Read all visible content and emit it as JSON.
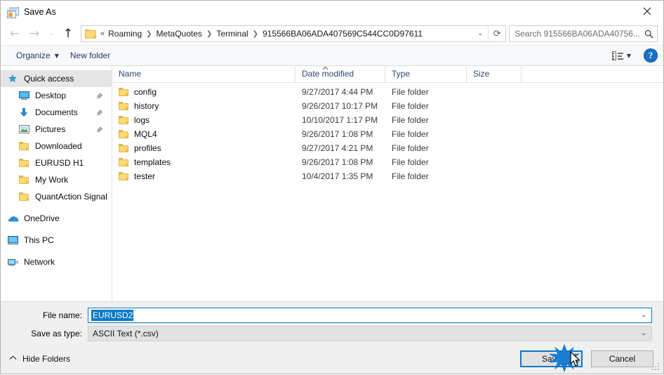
{
  "window": {
    "title": "Save As",
    "icon": "save-as-app-icon",
    "close_label": "✕"
  },
  "nav": {
    "back_icon": "back-arrow-icon",
    "forward_icon": "forward-arrow-icon",
    "recent_icon": "recent-locations-chevron-icon",
    "up_icon": "up-arrow-icon",
    "back_glyph": "←",
    "forward_glyph": "→",
    "recent_glyph": "⌄",
    "up_glyph": "↑"
  },
  "address": {
    "folder_icon": "folder-icon",
    "overflow": "«",
    "crumbs": [
      "Roaming",
      "MetaQuotes",
      "Terminal",
      "915566BA06ADA407569C544CC0D97611"
    ],
    "separator": "❯",
    "dropdown_glyph": "⌄",
    "refresh_glyph": "⟳"
  },
  "search": {
    "placeholder": "Search 915566BA06ADA40756...",
    "icon": "search-icon"
  },
  "command_bar": {
    "organize_label": "Organize",
    "organize_caret": "▼",
    "new_folder_label": "New folder",
    "view_caret": "▼",
    "help_label": "?"
  },
  "sidebar": {
    "items": [
      {
        "label": "Quick access",
        "icon": "star-pin-icon",
        "selected": true,
        "indent": 0,
        "pinned": false
      },
      {
        "label": "Desktop",
        "icon": "desktop-icon",
        "selected": false,
        "indent": 1,
        "pinned": true
      },
      {
        "label": "Documents",
        "icon": "documents-download-icon",
        "selected": false,
        "indent": 1,
        "pinned": true
      },
      {
        "label": "Pictures",
        "icon": "pictures-icon",
        "selected": false,
        "indent": 1,
        "pinned": true
      },
      {
        "label": "Downloaded",
        "icon": "folder-icon",
        "selected": false,
        "indent": 1,
        "pinned": false
      },
      {
        "label": "EURUSD H1",
        "icon": "folder-icon",
        "selected": false,
        "indent": 1,
        "pinned": false
      },
      {
        "label": "My Work",
        "icon": "folder-icon",
        "selected": false,
        "indent": 1,
        "pinned": false
      },
      {
        "label": "QuantAction Signal",
        "icon": "folder-icon",
        "selected": false,
        "indent": 1,
        "pinned": false
      }
    ],
    "groups": [
      {
        "label": "OneDrive",
        "icon": "onedrive-cloud-icon"
      },
      {
        "label": "This PC",
        "icon": "this-pc-icon"
      },
      {
        "label": "Network",
        "icon": "network-icon"
      }
    ],
    "pin_glyph": "📌"
  },
  "filelist": {
    "columns": [
      "Name",
      "Date modified",
      "Type",
      "Size"
    ],
    "sort_caret": "▲",
    "rows": [
      {
        "name": "config",
        "date": "9/27/2017 4:44 PM",
        "type": "File folder",
        "size": ""
      },
      {
        "name": "history",
        "date": "9/26/2017 10:17 PM",
        "type": "File folder",
        "size": ""
      },
      {
        "name": "logs",
        "date": "10/10/2017 1:17 PM",
        "type": "File folder",
        "size": ""
      },
      {
        "name": "MQL4",
        "date": "9/26/2017 1:08 PM",
        "type": "File folder",
        "size": ""
      },
      {
        "name": "profiles",
        "date": "9/27/2017 4:21 PM",
        "type": "File folder",
        "size": ""
      },
      {
        "name": "templates",
        "date": "9/26/2017 1:08 PM",
        "type": "File folder",
        "size": ""
      },
      {
        "name": "tester",
        "date": "10/4/2017 1:35 PM",
        "type": "File folder",
        "size": ""
      }
    ]
  },
  "form": {
    "filename_label": "File name:",
    "filename_value": "EURUSD2",
    "filetype_label": "Save as type:",
    "filetype_value": "ASCII Text (*.csv)",
    "dropdown_glyph": "⌄"
  },
  "footer": {
    "hide_folders_label": "Hide Folders",
    "hide_folders_chevron": "⌃",
    "save_label": "Save",
    "cancel_label": "Cancel"
  },
  "colors": {
    "accent": "#0a7ac6",
    "folder": "#fcd975",
    "header_text": "#2b4a73",
    "help_blue": "#1a6fc4",
    "selection": "#e5e5e5"
  }
}
